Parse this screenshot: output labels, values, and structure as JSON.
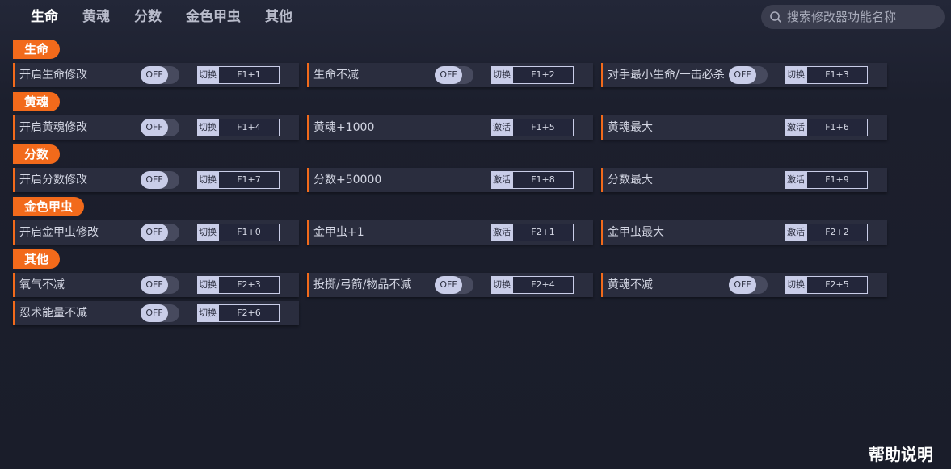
{
  "tabs": [
    "生命",
    "黄魂",
    "分数",
    "金色甲虫",
    "其他"
  ],
  "search": {
    "placeholder": "搜索修改器功能名称"
  },
  "sections": [
    {
      "label": "生命",
      "rows": [
        [
          {
            "name": "开启生命修改",
            "toggle": "OFF",
            "action": "切换",
            "key": "F1+1"
          },
          {
            "name": "生命不减",
            "toggle": "OFF",
            "action": "切换",
            "key": "F1+2"
          },
          {
            "name": "对手最小生命/一击必杀",
            "toggle": "OFF",
            "action": "切换",
            "key": "F1+3"
          }
        ]
      ]
    },
    {
      "label": "黄魂",
      "rows": [
        [
          {
            "name": "开启黄魂修改",
            "toggle": "OFF",
            "action": "切换",
            "key": "F1+4"
          },
          {
            "name": "黄魂+1000",
            "action": "激活",
            "key": "F1+5"
          },
          {
            "name": "黄魂最大",
            "action": "激活",
            "key": "F1+6"
          }
        ]
      ]
    },
    {
      "label": "分数",
      "rows": [
        [
          {
            "name": "开启分数修改",
            "toggle": "OFF",
            "action": "切换",
            "key": "F1+7"
          },
          {
            "name": "分数+50000",
            "action": "激活",
            "key": "F1+8"
          },
          {
            "name": "分数最大",
            "action": "激活",
            "key": "F1+9"
          }
        ]
      ]
    },
    {
      "label": "金色甲虫",
      "rows": [
        [
          {
            "name": "开启金甲虫修改",
            "toggle": "OFF",
            "action": "切换",
            "key": "F1+0"
          },
          {
            "name": "金甲虫+1",
            "action": "激活",
            "key": "F2+1"
          },
          {
            "name": "金甲虫最大",
            "action": "激活",
            "key": "F2+2"
          }
        ]
      ]
    },
    {
      "label": "其他",
      "rows": [
        [
          {
            "name": "氧气不减",
            "toggle": "OFF",
            "action": "切换",
            "key": "F2+3"
          },
          {
            "name": "投掷/弓箭/物品不减",
            "toggle": "OFF",
            "action": "切换",
            "key": "F2+4"
          },
          {
            "name": "黄魂不减",
            "toggle": "OFF",
            "action": "切换",
            "key": "F2+5"
          }
        ],
        [
          {
            "name": "忍术能量不减",
            "toggle": "OFF",
            "action": "切换",
            "key": "F2+6"
          }
        ]
      ]
    }
  ],
  "help": "帮助说明"
}
